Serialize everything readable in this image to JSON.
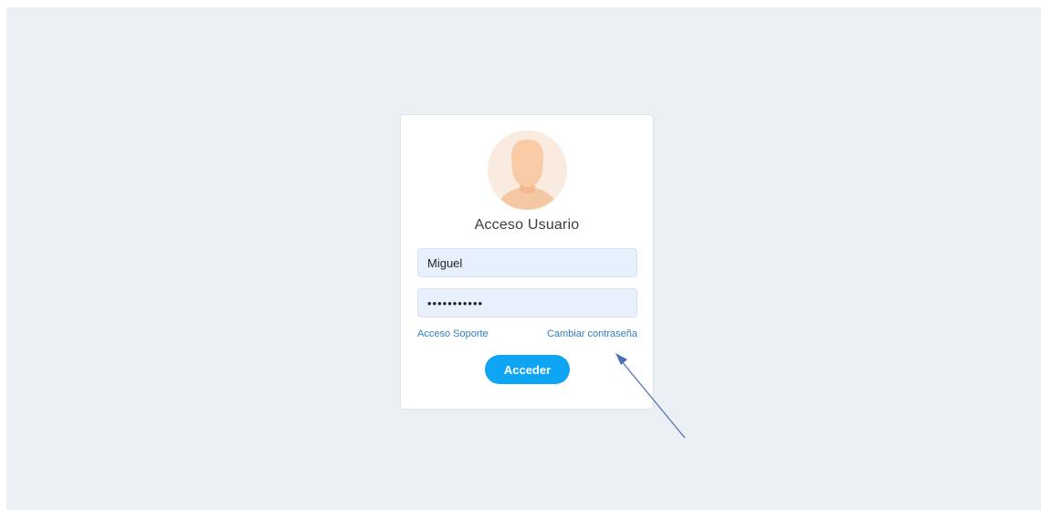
{
  "login": {
    "title": "Acceso Usuario",
    "username_value": "Miguel",
    "password_value": "•••••••••••",
    "support_link": "Acceso Soporte",
    "change_password_link": "Cambiar contraseña",
    "submit_label": "Acceder"
  },
  "colors": {
    "background": "#eceff3",
    "input_fill": "#e8f0fe",
    "link": "#2f7fc1",
    "button": "#0ea5f5",
    "annotation_arrow": "#4a6fb5"
  },
  "icons": {
    "avatar": "user-avatar-icon",
    "annotation": "arrow-annotation-icon"
  }
}
